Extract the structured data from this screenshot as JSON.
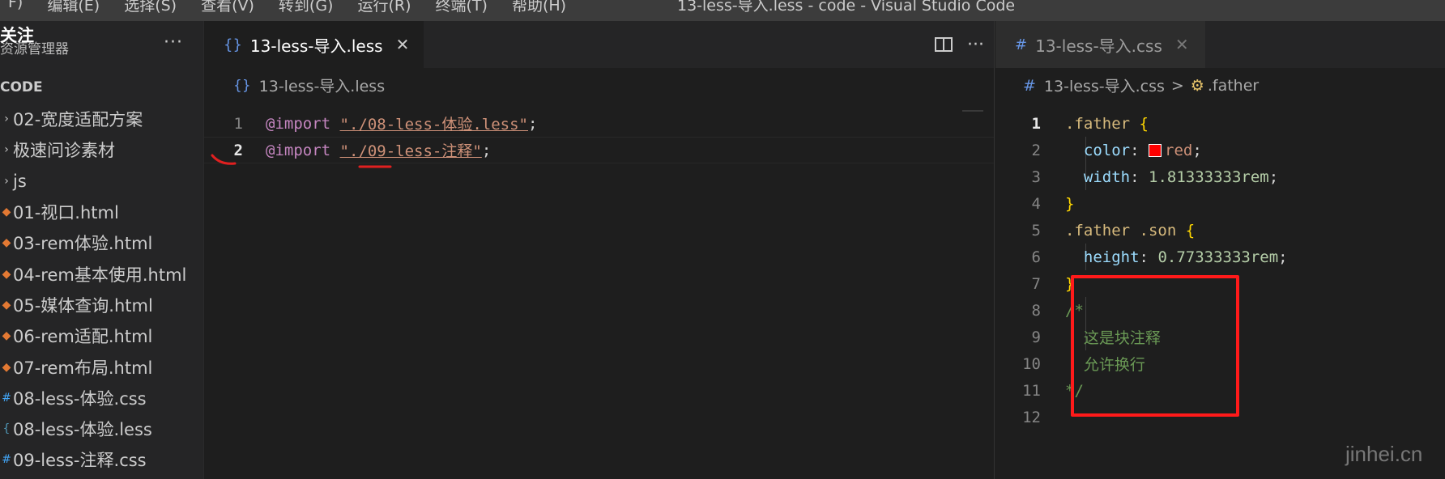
{
  "window": {
    "menu": [
      "F)",
      "编辑(E)",
      "选择(S)",
      "查看(V)",
      "转到(G)",
      "运行(R)",
      "终端(T)",
      "帮助(H)"
    ],
    "title": "13-less-导入.less - code - Visual Studio Code"
  },
  "overlay": {
    "follow": "关注",
    "watermark": "jinhei.cn"
  },
  "sidebar": {
    "title": "资源管理器",
    "more": "···",
    "section": "CODE",
    "files": [
      {
        "icon": "chevron-right-icon",
        "name": "02-宽度适配方案"
      },
      {
        "icon": "chevron-right-icon",
        "name": "极速问诊素材"
      },
      {
        "icon": "chevron-right-icon",
        "name": "js"
      },
      {
        "icon": "html-file-icon",
        "name": "01-视口.html"
      },
      {
        "icon": "html-file-icon",
        "name": "03-rem体验.html"
      },
      {
        "icon": "html-file-icon",
        "name": "04-rem基本使用.html"
      },
      {
        "icon": "html-file-icon",
        "name": "05-媒体查询.html"
      },
      {
        "icon": "html-file-icon",
        "name": "06-rem适配.html"
      },
      {
        "icon": "html-file-icon",
        "name": "07-rem布局.html"
      },
      {
        "icon": "css-file-icon",
        "name": "08-less-体验.css"
      },
      {
        "icon": "less-file-icon",
        "name": "08-less-体验.less"
      },
      {
        "icon": "css-file-icon",
        "name": "09-less-注释.css"
      }
    ]
  },
  "editor_left": {
    "tab": {
      "icon": "{}",
      "label": "13-less-导入.less",
      "close": "✕"
    },
    "actions_more": "···",
    "breadcrumb": {
      "icon": "{}",
      "label": "13-less-导入.less"
    },
    "lines": [
      {
        "num": "1",
        "kw": "@import",
        "str": "\"./08-less-体验.less\"",
        "end": ";"
      },
      {
        "num": "2",
        "kw": "@import",
        "str": "\"./09-less-注释\"",
        "end": ";"
      }
    ]
  },
  "editor_right": {
    "tab": {
      "icon": "#",
      "label": "13-less-导入.css",
      "close": "✕"
    },
    "breadcrumb": {
      "icon": "#",
      "file": "13-less-导入.css",
      "sep": ">",
      "symbol": ".father"
    },
    "line_numbers": [
      "1",
      "2",
      "3",
      "4",
      "5",
      "6",
      "7",
      "8",
      "9",
      "10",
      "11",
      "12"
    ],
    "code": {
      "l1_sel": ".father",
      "l1_brace": "{",
      "l2_prop": "color",
      "l2_colon": ":",
      "l2_val": "red",
      "l2_end": ";",
      "l3_prop": "width",
      "l3_colon": ":",
      "l3_val": "1.81333333rem",
      "l3_end": ";",
      "l4_brace": "}",
      "l5_sel": ".father .son",
      "l5_brace": "{",
      "l6_prop": "height",
      "l6_colon": ":",
      "l6_val": "0.77333333rem",
      "l6_end": ";",
      "l7_brace": "}",
      "l8_cmt": "/*",
      "l9_cmt": "这是块注释",
      "l10_cmt": "允许换行",
      "l11_cmt": "*/"
    },
    "swatch_color": "#ff0000"
  }
}
